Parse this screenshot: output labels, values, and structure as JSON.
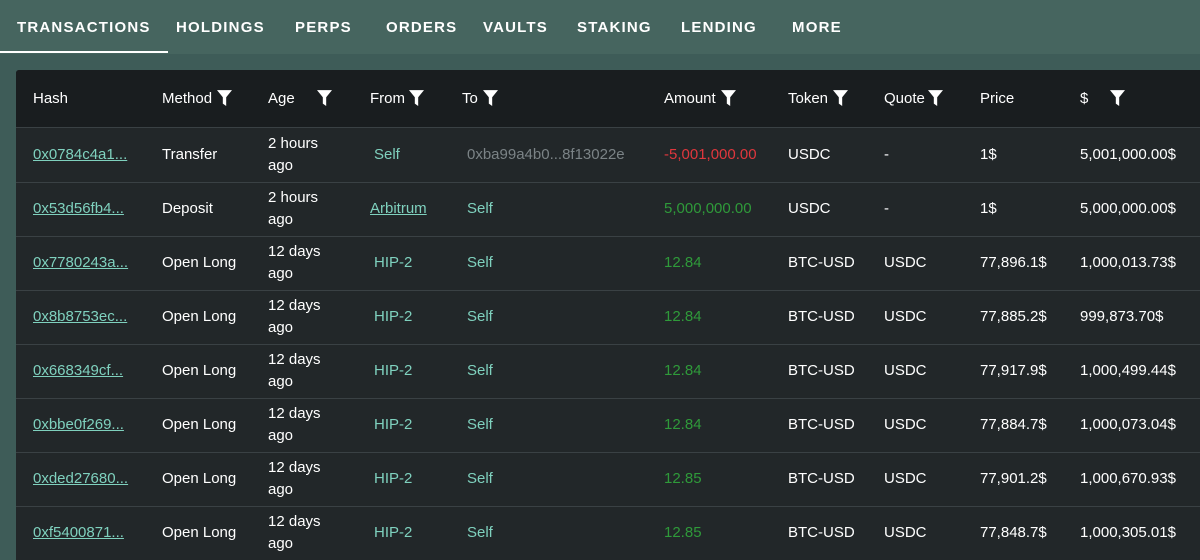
{
  "tabs": [
    {
      "label": "TRANSACTIONS",
      "active": true
    },
    {
      "label": "HOLDINGS",
      "active": false
    },
    {
      "label": "PERPS",
      "active": false
    },
    {
      "label": "ORDERS",
      "active": false
    },
    {
      "label": "VAULTS",
      "active": false
    },
    {
      "label": "STAKING",
      "active": false
    },
    {
      "label": "LENDING",
      "active": false
    },
    {
      "label": "MORE",
      "active": false
    }
  ],
  "table": {
    "headers": {
      "hash": "Hash",
      "method": "Method",
      "age": "Age",
      "from": "From",
      "to": "To",
      "amount": "Amount",
      "token": "Token",
      "quote": "Quote",
      "price": "Price",
      "usd": "$"
    },
    "rows": [
      {
        "hash": "0x0784c4a1...",
        "method": "Transfer",
        "age": "2 hours ago",
        "from": "Self",
        "to": "0xba99a4b0...8f13022e",
        "amount": "-5,001,000.00",
        "token": "USDC",
        "quote": "-",
        "price": "1$",
        "usd": "5,001,000.00$"
      },
      {
        "hash": "0x53d56fb4...",
        "method": "Deposit",
        "age": "2 hours ago",
        "from": "Arbitrum",
        "to": "Self",
        "amount": "5,000,000.00",
        "token": "USDC",
        "quote": "-",
        "price": "1$",
        "usd": "5,000,000.00$"
      },
      {
        "hash": "0x7780243a...",
        "method": "Open Long",
        "age": "12 days ago",
        "from": "HIP-2",
        "to": "Self",
        "amount": "12.84",
        "token": "BTC-USD",
        "quote": "USDC",
        "price": "77,896.1$",
        "usd": "1,000,013.73$"
      },
      {
        "hash": "0x8b8753ec...",
        "method": "Open Long",
        "age": "12 days ago",
        "from": "HIP-2",
        "to": "Self",
        "amount": "12.84",
        "token": "BTC-USD",
        "quote": "USDC",
        "price": "77,885.2$",
        "usd": "999,873.70$"
      },
      {
        "hash": "0x668349cf...",
        "method": "Open Long",
        "age": "12 days ago",
        "from": "HIP-2",
        "to": "Self",
        "amount": "12.84",
        "token": "BTC-USD",
        "quote": "USDC",
        "price": "77,917.9$",
        "usd": "1,000,499.44$"
      },
      {
        "hash": "0xbbe0f269...",
        "method": "Open Long",
        "age": "12 days ago",
        "from": "HIP-2",
        "to": "Self",
        "amount": "12.84",
        "token": "BTC-USD",
        "quote": "USDC",
        "price": "77,884.7$",
        "usd": "1,000,073.04$"
      },
      {
        "hash": "0xded27680...",
        "method": "Open Long",
        "age": "12 days ago",
        "from": "HIP-2",
        "to": "Self",
        "amount": "12.85",
        "token": "BTC-USD",
        "quote": "USDC",
        "price": "77,901.2$",
        "usd": "1,000,670.93$"
      },
      {
        "hash": "0xf5400871...",
        "method": "Open Long",
        "age": "12 days ago",
        "from": "HIP-2",
        "to": "Self",
        "amount": "12.85",
        "token": "BTC-USD",
        "quote": "USDC",
        "price": "77,848.7$",
        "usd": "1,000,305.01$"
      }
    ]
  },
  "icons": {
    "filter": "filter-icon"
  },
  "colors": {
    "tab_bar": "#46655f",
    "background": "#3e5c58",
    "panel": "#222729",
    "header": "#191d1f",
    "link": "#7fd1be",
    "positive": "#2f9a3a",
    "negative": "#e0373d",
    "muted": "#7b8386"
  }
}
